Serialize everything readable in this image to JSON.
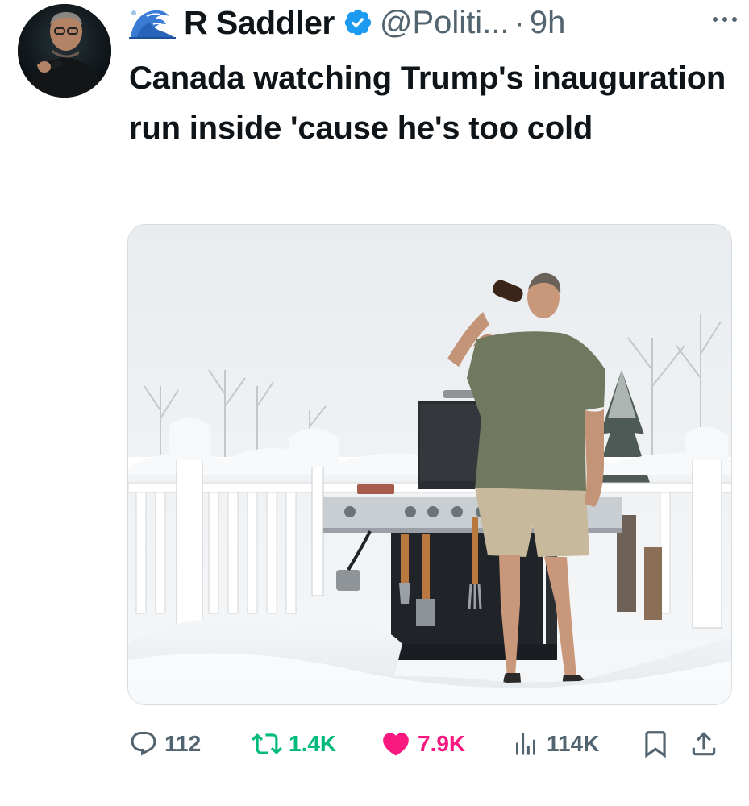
{
  "tweet": {
    "display_name": "R Saddler",
    "handle": "@Politi...",
    "separator": "·",
    "time": "9h",
    "text": "Canada watching Trump's inauguration run inside 'cause he's too cold",
    "verified": true,
    "name_emoji_icon": "water-wave-icon",
    "colors": {
      "verified": "#1d9bf0",
      "retweet": "#00ba7c",
      "like": "#f91880",
      "muted": "#536471"
    }
  },
  "actions": {
    "replies": "112",
    "retweets": "1.4K",
    "likes": "7.9K",
    "views": "114K",
    "liked": true,
    "retweeted": false,
    "icons": [
      "reply-icon",
      "retweet-icon",
      "like-icon",
      "views-icon",
      "bookmark-icon",
      "share-icon"
    ]
  }
}
